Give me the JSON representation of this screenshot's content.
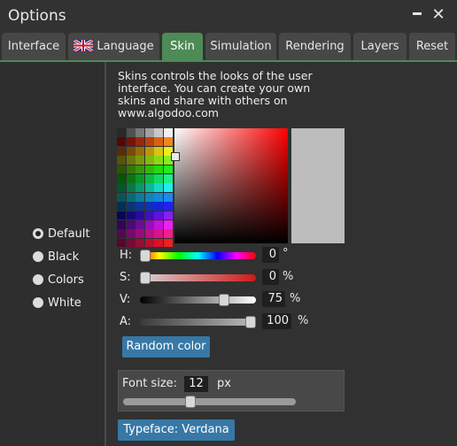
{
  "window": {
    "title": "Options",
    "minimize_label": "_",
    "close_label": "✕"
  },
  "tabs": [
    {
      "label": "Interface",
      "active": false
    },
    {
      "label": "Language",
      "active": false,
      "icon": "uk-flag-icon"
    },
    {
      "label": "Skin",
      "active": true
    },
    {
      "label": "Simulation",
      "active": false
    },
    {
      "label": "Rendering",
      "active": false
    },
    {
      "label": "Layers",
      "active": false
    },
    {
      "label": "Reset",
      "active": false
    }
  ],
  "skins": {
    "options": [
      "Default",
      "Black",
      "Colors",
      "White"
    ],
    "selected": "Default"
  },
  "description": "Skins controls the looks of the user interface. You can create your own skins and share with others on www.algodoo.com",
  "color": {
    "preview": "#bdbdbd",
    "hue": {
      "label": "H:",
      "value": "0",
      "unit": "°",
      "fraction": 0.0
    },
    "saturation": {
      "label": "S:",
      "value": "0",
      "unit": "%",
      "fraction": 0.0
    },
    "value": {
      "label": "V:",
      "value": "75",
      "unit": "%",
      "fraction": 0.75
    },
    "alpha": {
      "label": "A:",
      "value": "100",
      "unit": "%",
      "fraction": 1.0
    }
  },
  "random_color_label": "Random color",
  "font": {
    "label": "Font size:",
    "value": "12",
    "unit": "px",
    "fraction": 0.38
  },
  "typeface_label": "Typeface: Verdana",
  "colors": {
    "accent": "#4d8a55",
    "button": "#3778a6",
    "background": "#323232"
  }
}
